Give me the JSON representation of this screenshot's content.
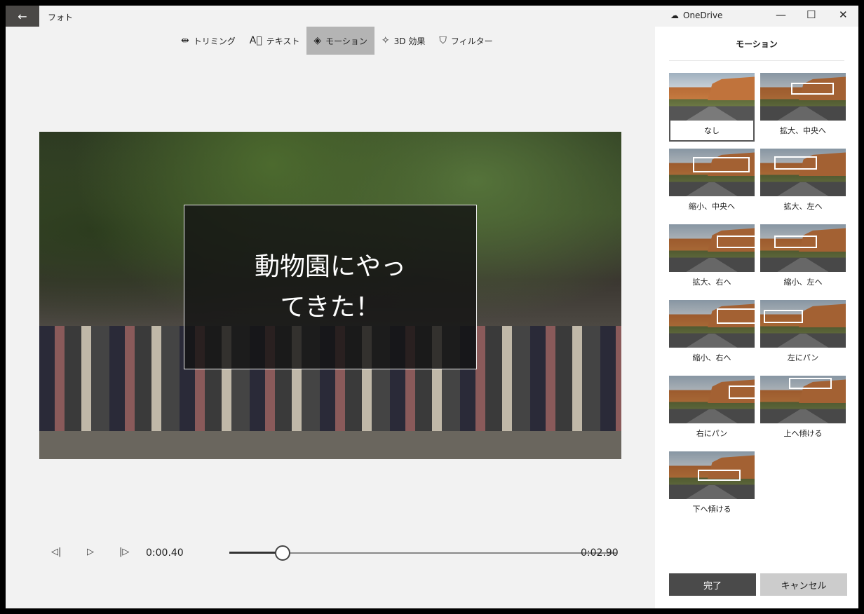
{
  "app": {
    "title": "フォト",
    "back_icon": "arrow-left-icon"
  },
  "toolbar": [
    {
      "label": "トリミング",
      "icon": "trim-icon",
      "glyph": "⇹"
    },
    {
      "label": "テキスト",
      "icon": "text-icon",
      "glyph": "A⃞"
    },
    {
      "label": "モーション",
      "icon": "motion-icon",
      "glyph": "◈",
      "active": true
    },
    {
      "label": "3D 効果",
      "icon": "3d-effects-icon",
      "glyph": "✧"
    },
    {
      "label": "フィルター",
      "icon": "filter-icon",
      "glyph": "⛉"
    }
  ],
  "video": {
    "caption": "動物園にやっ\nてきた！"
  },
  "playback": {
    "current": "0:00.40",
    "total": "0:02.90",
    "progress": 0.138
  },
  "titlebar": {
    "account": "OneDrive",
    "minimize": "—",
    "maximize": "☐",
    "close": "✕"
  },
  "panel": {
    "title": "モーション",
    "items": [
      {
        "label": "なし",
        "selected": true
      },
      {
        "label": "拡大、中央へ"
      },
      {
        "label": "縮小、中央へ"
      },
      {
        "label": "拡大、左へ"
      },
      {
        "label": "拡大、右へ"
      },
      {
        "label": "縮小、左へ"
      },
      {
        "label": "縮小、右へ"
      },
      {
        "label": "左にパン"
      },
      {
        "label": "右にパン"
      },
      {
        "label": "上へ傾ける"
      },
      {
        "label": "下へ傾ける"
      }
    ],
    "done": "完了",
    "cancel": "キャンセル"
  }
}
